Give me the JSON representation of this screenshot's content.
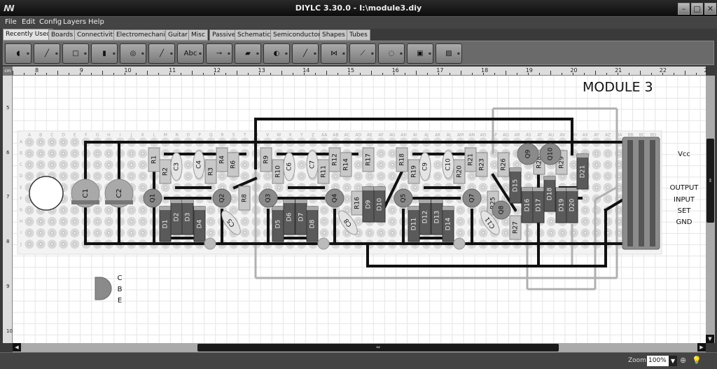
{
  "window": {
    "title": "DIYLC 3.30.0 - I:\\module3.diy",
    "minimize": "–",
    "maximize": "□",
    "close": "✕",
    "logo": "ꟿ"
  },
  "menu": [
    "File",
    "Edit",
    "Config",
    "Layers",
    "Help"
  ],
  "tabs": [
    {
      "label": "Recently Used",
      "active": true
    },
    {
      "label": "Boards"
    },
    {
      "label": "Connectivity"
    },
    {
      "label": "Electromechanical"
    },
    {
      "label": "Guitar"
    },
    {
      "label": "Misc"
    },
    {
      "label": "Passive"
    },
    {
      "label": "Schematics"
    },
    {
      "label": "Semiconductors"
    },
    {
      "label": "Shapes"
    },
    {
      "label": "Tubes"
    }
  ],
  "toolbar": [
    {
      "icon": "perfboard-icon"
    },
    {
      "icon": "wire-icon"
    },
    {
      "icon": "rectangle-icon"
    },
    {
      "icon": "stripboard-icon"
    },
    {
      "icon": "eyelet-icon"
    },
    {
      "icon": "jumper-icon"
    },
    {
      "icon": "label-icon",
      "text": "Abc"
    },
    {
      "icon": "resistor-icon"
    },
    {
      "icon": "diode-icon"
    },
    {
      "icon": "electrolytic-capacitor-icon"
    },
    {
      "icon": "trace-icon"
    },
    {
      "icon": "transistor-symbol-icon"
    },
    {
      "icon": "film-capacitor-icon"
    },
    {
      "icon": "pot-icon"
    },
    {
      "icon": "to220-icon"
    },
    {
      "icon": "image-icon"
    }
  ],
  "ruler": {
    "unit": "cm",
    "top": [
      "8",
      "9",
      "10",
      "11",
      "12",
      "13",
      "14",
      "15",
      "16",
      "17",
      "18",
      "19",
      "20",
      "21",
      "22",
      "2"
    ],
    "left": [
      "5",
      "6",
      "7",
      "8",
      "9",
      "10"
    ]
  },
  "board": {
    "columns": [
      "A",
      "B",
      "C",
      "D",
      "E",
      "F",
      "G",
      "H",
      "I",
      "J",
      "K",
      "L",
      "M",
      "N",
      "O",
      "P",
      "Q",
      "R",
      "S",
      "T",
      "U",
      "V",
      "W",
      "X",
      "Y",
      "Z",
      "AA",
      "AB",
      "AC",
      "AD",
      "AE",
      "AF",
      "AG",
      "AH",
      "AI",
      "AJ",
      "AK",
      "AL",
      "AM",
      "AN",
      "AO",
      "AP",
      "AQ",
      "AR",
      "AS",
      "AT",
      "AU",
      "AV",
      "AW",
      "AX",
      "AY",
      "AZ",
      "BA",
      "BB",
      "BC",
      "BD"
    ],
    "rows": [
      "A",
      "B",
      "C",
      "D",
      "E",
      "F",
      "G",
      "H",
      "I",
      "J"
    ],
    "title": "MODULE 3",
    "terminals": [
      "Vcc",
      "OUTPUT",
      "INPUT",
      "SET",
      "GND"
    ],
    "pinout": [
      "C",
      "B",
      "E"
    ],
    "resistors": [
      "R1",
      "R2",
      "R3",
      "R4",
      "R6",
      "R8",
      "R9",
      "R10",
      "R11",
      "R12",
      "R14",
      "R16",
      "R17",
      "R18",
      "R19",
      "R20",
      "R21",
      "R23",
      "R25",
      "R26",
      "R27",
      "R28",
      "R29"
    ],
    "capacitors": [
      "C3",
      "C4",
      "C5",
      "C6",
      "C7",
      "C8",
      "C9",
      "C10",
      "C11"
    ],
    "electrolytics": [
      "C1",
      "C2"
    ],
    "transistors": [
      "Q1",
      "Q2",
      "Q3",
      "Q4",
      "Q5",
      "Q7",
      "Q8",
      "Q9",
      "Q10"
    ],
    "diodes": [
      "D1",
      "D2",
      "D3",
      "D4",
      "D5",
      "D6",
      "D7",
      "D8",
      "D9",
      "D10",
      "D11",
      "D12",
      "D13",
      "D14",
      "D15",
      "D16",
      "D17",
      "D18",
      "D19",
      "D20",
      "D21"
    ]
  },
  "status": {
    "zoom_label": "Zoom:",
    "zoom_value": "100%"
  },
  "colors": {
    "trace": "#111111",
    "wire": "#b0b0b0",
    "resistor": "#c8c8c8",
    "diode": "#5a5a5a",
    "transistor": "#8a8a8a"
  }
}
